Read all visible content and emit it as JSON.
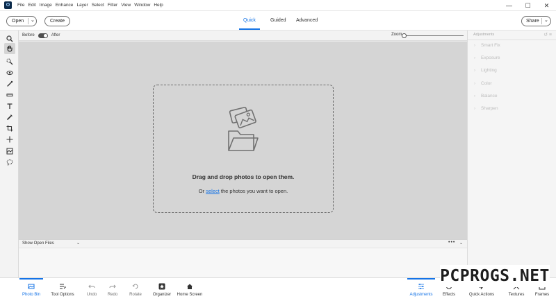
{
  "app": {
    "icon_letter": "O"
  },
  "menu": [
    "File",
    "Edit",
    "Image",
    "Enhance",
    "Layer",
    "Select",
    "Filter",
    "View",
    "Window",
    "Help"
  ],
  "window_controls": {
    "minimize": "—",
    "maximize": "☐",
    "close": "✕"
  },
  "topbar": {
    "open_label": "Open",
    "create_label": "Create",
    "share_label": "Share",
    "tabs": [
      {
        "label": "Quick",
        "active": true
      },
      {
        "label": "Guided",
        "active": false
      },
      {
        "label": "Advanced",
        "active": false
      }
    ]
  },
  "view_bar": {
    "before_label": "Before",
    "after_label": "After",
    "zoom_label": "Zoom",
    "zoom_value": "1%"
  },
  "tools": [
    "zoom-icon",
    "hand-icon",
    "quick-selection-icon",
    "eye-icon",
    "whiten-teeth-icon",
    "straighten-icon",
    "text-icon",
    "spot-healing-icon",
    "crop-icon",
    "move-icon",
    "content-aware-icon",
    "lasso-icon"
  ],
  "canvas": {
    "drop_title": "Drag and drop photos to open them.",
    "drop_prefix": "Or",
    "drop_link": "select",
    "drop_suffix": "the photos you want to open."
  },
  "adjustments": {
    "header": "Adjustments",
    "items": [
      "Smart Fix",
      "Exposure",
      "Lighting",
      "Color",
      "Balance",
      "Sharpen"
    ]
  },
  "photo_bin": {
    "selector": "Show Open Files",
    "menu_dots": "•••"
  },
  "bottom": {
    "left": [
      {
        "label": "Photo Bin",
        "icon": "photo-bin-icon",
        "active": true
      },
      {
        "label": "Tool Options",
        "icon": "tool-options-icon",
        "active": false
      },
      {
        "label": "Undo",
        "icon": "undo-icon",
        "active": false
      },
      {
        "label": "Redo",
        "icon": "redo-icon",
        "active": false
      },
      {
        "label": "Rotate",
        "icon": "rotate-icon",
        "active": false
      },
      {
        "label": "Organizer",
        "icon": "organizer-icon",
        "active": false
      },
      {
        "label": "Home Screen",
        "icon": "home-icon",
        "active": false
      }
    ],
    "right": [
      {
        "label": "Adjustments",
        "icon": "adjustments-icon",
        "active": true
      },
      {
        "label": "Effects",
        "icon": "effects-icon",
        "active": false
      },
      {
        "label": "Quick Actions",
        "icon": "quick-actions-icon",
        "active": false
      },
      {
        "label": "Textures",
        "icon": "textures-icon",
        "active": false
      },
      {
        "label": "Frames",
        "icon": "frames-icon",
        "active": false
      }
    ]
  },
  "watermark": "PCPROGS.NET",
  "colors": {
    "accent": "#1473e6",
    "canvas": "#d5d5d5"
  }
}
